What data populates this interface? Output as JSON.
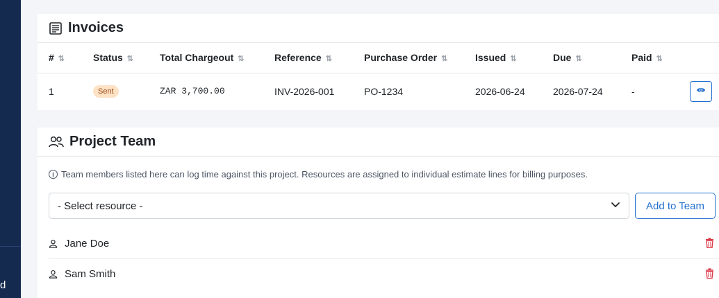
{
  "sidebar": {
    "stub_text": "d"
  },
  "invoices": {
    "title": "Invoices",
    "columns": [
      "#",
      "Status",
      "Total Chargeout",
      "Reference",
      "Purchase Order",
      "Issued",
      "Due",
      "Paid"
    ],
    "rows": [
      {
        "num": "1",
        "status": "Sent",
        "total": "ZAR 3,700.00",
        "reference": "INV-2026-001",
        "purchase_order": "PO-1234",
        "issued": "2026-06-24",
        "due": "2026-07-24",
        "paid": "-"
      }
    ],
    "view_icon": "eye-icon"
  },
  "team": {
    "title": "Project Team",
    "info": "Team members listed here can log time against this project. Resources are assigned to individual estimate lines for billing purposes.",
    "select_value": "- Select resource -",
    "add_label": "Add to Team",
    "members": [
      {
        "name": "Jane Doe"
      },
      {
        "name": "Sam Smith"
      }
    ]
  },
  "colors": {
    "accent": "#1f6fd1",
    "sidebar": "#142a4e",
    "danger": "#dc3545",
    "badge_bg": "#fde2c6"
  }
}
